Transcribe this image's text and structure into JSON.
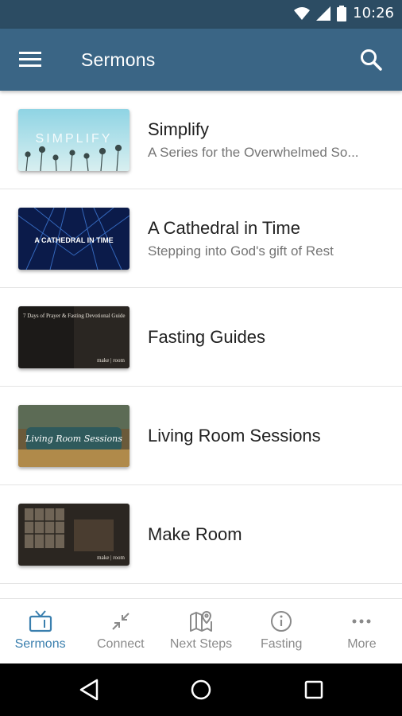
{
  "status": {
    "time": "10:26"
  },
  "header": {
    "title": "Sermons"
  },
  "series": [
    {
      "title": "Simplify",
      "subtitle": "A Series for the Overwhelmed So...",
      "thumb_text": "SIMPLIFY"
    },
    {
      "title": "A Cathedral in Time",
      "subtitle": "Stepping into God's gift of Rest",
      "thumb_text": "A CATHEDRAL IN TIME"
    },
    {
      "title": "Fasting Guides",
      "subtitle": "",
      "thumb_text": "7 Days of Prayer & Fasting Devotional Guide",
      "thumb_brand": "make | room"
    },
    {
      "title": "Living Room Sessions",
      "subtitle": "",
      "thumb_text": "Living Room Sessions"
    },
    {
      "title": "Make Room",
      "subtitle": "",
      "thumb_brand": "make | room"
    }
  ],
  "bottom_nav": [
    {
      "label": "Sermons",
      "icon": "tv-icon",
      "active": true
    },
    {
      "label": "Connect",
      "icon": "connect-arrows-icon"
    },
    {
      "label": "Next Steps",
      "icon": "map-pin-icon"
    },
    {
      "label": "Fasting",
      "icon": "info-icon"
    },
    {
      "label": "More",
      "icon": "more-dots-icon"
    }
  ],
  "colors": {
    "appbar": "#3a6585",
    "statusbar": "#2c4c63",
    "accent": "#3a7fae"
  }
}
